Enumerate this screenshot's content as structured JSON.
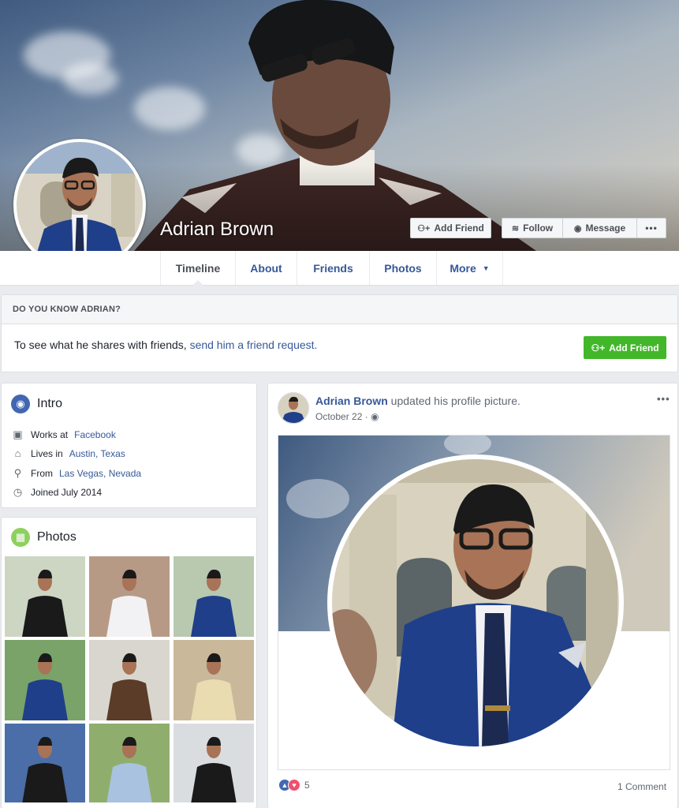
{
  "profile": {
    "name": "Adrian Brown",
    "buttons": {
      "add_friend": "Add Friend",
      "follow": "Follow",
      "message": "Message",
      "more": "•••"
    }
  },
  "nav": {
    "tabs": [
      {
        "label": "Timeline",
        "active": true
      },
      {
        "label": "About"
      },
      {
        "label": "Friends"
      },
      {
        "label": "Photos"
      },
      {
        "label": "More"
      }
    ]
  },
  "know_box": {
    "heading": "DO YOU KNOW ADRIAN?",
    "text": "To see what he shares with friends,",
    "link": "send him a friend request.",
    "button": "Add Friend"
  },
  "intro": {
    "title": "Intro",
    "items": [
      {
        "icon": "briefcase-icon",
        "prefix": "Works at",
        "link": "Facebook"
      },
      {
        "icon": "home-icon",
        "prefix": "Lives in",
        "link": "Austin, Texas"
      },
      {
        "icon": "location-pin-icon",
        "prefix": "From",
        "link": "Las Vegas, Nevada"
      },
      {
        "icon": "clock-icon",
        "prefix": "Joined July 2014",
        "link": ""
      }
    ]
  },
  "photos": {
    "title": "Photos"
  },
  "post": {
    "author": "Adrian Brown",
    "action": "updated his profile picture.",
    "date": "October 22 ·",
    "reaction_count": "5",
    "comments": "1 Comment",
    "menu": "•••"
  },
  "colors": {
    "link": "#365899",
    "green": "#42b72a",
    "background": "#e9ebee"
  }
}
